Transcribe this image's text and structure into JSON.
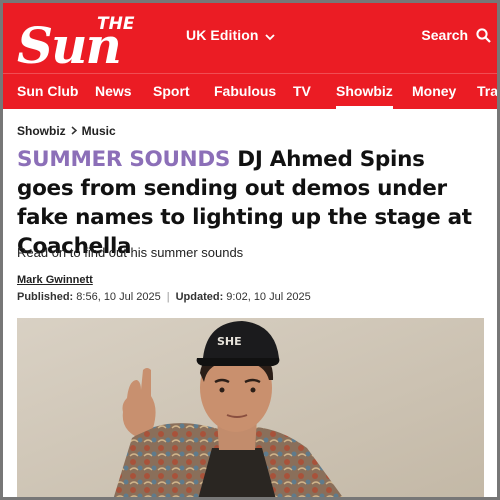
{
  "header": {
    "logo_text": "The Sun",
    "edition_label": "UK Edition",
    "search_label": "Search"
  },
  "nav": {
    "items": [
      {
        "label": "Sun Club"
      },
      {
        "label": "News"
      },
      {
        "label": "Sport"
      },
      {
        "label": "Fabulous"
      },
      {
        "label": "TV"
      },
      {
        "label": "Showbiz",
        "active": true
      },
      {
        "label": "Money"
      },
      {
        "label": "Tra"
      }
    ]
  },
  "breadcrumb": {
    "section": "Showbiz",
    "subsection": "Music"
  },
  "article": {
    "kicker": "SUMMER SOUNDS",
    "headline": "DJ Ahmed Spins goes from sending out demos under fake names to lighting up the stage at Coachella",
    "standfirst": "Read on to find out his summer sounds",
    "author": "Mark Gwinnett",
    "published_label": "Published:",
    "published_value": "8:56, 10 Jul 2025",
    "updated_label": "Updated:",
    "updated_value": "9:02, 10 Jul 2025",
    "cap_text": "SHE"
  },
  "colors": {
    "brand_red": "#eb1c24",
    "kicker_purple": "#8c6fb8"
  }
}
